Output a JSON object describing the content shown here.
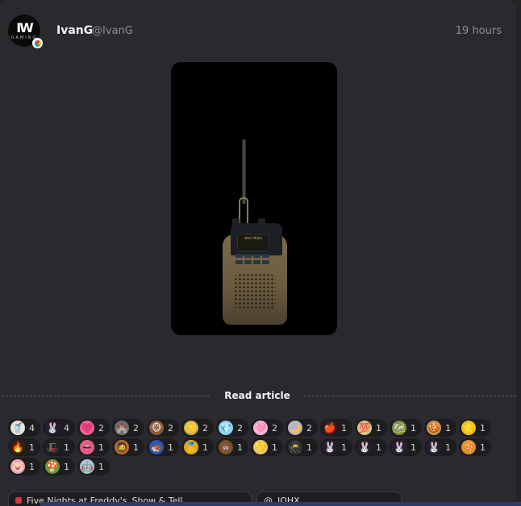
{
  "post": {
    "author_name": "IvanG",
    "author_handle": "@IvanG",
    "timestamp": "19 hours",
    "avatar_logo": "IW",
    "avatar_sub": "GAMING",
    "media_screen_text": "she's there"
  },
  "read_article_label": "Read article",
  "reactions": [
    {
      "icon": "milkshake-icon",
      "glyph": "🥤",
      "bg": "#e8e3dc",
      "count": "4"
    },
    {
      "icon": "bunny-mask-icon",
      "glyph": "🐰",
      "bg": "#2b1b33",
      "count": "4"
    },
    {
      "icon": "pink-heart-icon",
      "glyph": "💗",
      "bg": "#f06292",
      "count": "2"
    },
    {
      "icon": "castle-icon",
      "glyph": "🏰",
      "bg": "#6d6d72",
      "count": "2"
    },
    {
      "icon": "monkey-icon",
      "glyph": "🐵",
      "bg": "#8d5a3a",
      "count": "2"
    },
    {
      "icon": "gold-coin-icon",
      "glyph": "🪙",
      "bg": "#cdb04b",
      "count": "2"
    },
    {
      "icon": "diamond-icon",
      "glyph": "💎",
      "bg": "#8fd3ef",
      "count": "2"
    },
    {
      "icon": "heart-icon",
      "glyph": "🩷",
      "bg": "#f8b8d0",
      "count": "2"
    },
    {
      "icon": "moon-icon",
      "glyph": "🌙",
      "bg": "#b9b6c9",
      "count": "2"
    },
    {
      "icon": "apple-icon",
      "glyph": "🍎",
      "bg": "#3a1a1a",
      "count": "1"
    },
    {
      "icon": "hundred-icon",
      "glyph": "💯",
      "bg": "#d8c890",
      "count": "1"
    },
    {
      "icon": "map-icon",
      "glyph": "🗺",
      "bg": "#7a8f40",
      "count": "1"
    },
    {
      "icon": "cookie-icon",
      "glyph": "🍪",
      "bg": "#c9955a",
      "count": "1"
    },
    {
      "icon": "star-icon",
      "glyph": "⭐",
      "bg": "#f0c020",
      "count": "1"
    },
    {
      "icon": "fire-icon",
      "glyph": "🔥",
      "bg": "#3a2010",
      "count": "1"
    },
    {
      "icon": "top-hat-icon",
      "glyph": "🎩",
      "bg": "#222",
      "count": "1"
    },
    {
      "icon": "lips-icon",
      "glyph": "👄",
      "bg": "#e06080",
      "count": "1"
    },
    {
      "icon": "bearded-face-icon",
      "glyph": "🧔",
      "bg": "#b86a3a",
      "count": "1"
    },
    {
      "icon": "sonic-icon",
      "glyph": "🦔",
      "bg": "#2b56b8",
      "count": "1"
    },
    {
      "icon": "gold-medal-icon",
      "glyph": "🥇",
      "bg": "#e0a820",
      "count": "1"
    },
    {
      "icon": "poop-icon",
      "glyph": "💩",
      "bg": "#7a5028",
      "count": "1"
    },
    {
      "icon": "gold-heart-icon",
      "glyph": "💛",
      "bg": "#e6c86a",
      "count": "1"
    },
    {
      "icon": "hood-icon",
      "glyph": "🥷",
      "bg": "#303038",
      "count": "1"
    },
    {
      "icon": "bunny-mask-icon",
      "glyph": "🐰",
      "bg": "#2b1b33",
      "count": "1"
    },
    {
      "icon": "bunny-mask-icon",
      "glyph": "🐰",
      "bg": "#2b1b33",
      "count": "1"
    },
    {
      "icon": "bunny-mask-icon",
      "glyph": "🐰",
      "bg": "#2b1b33",
      "count": "1"
    },
    {
      "icon": "bunny-mask-icon",
      "glyph": "🐰",
      "bg": "#2b1b33",
      "count": "1"
    },
    {
      "icon": "pizza-icon",
      "glyph": "🍕",
      "bg": "#e09030",
      "count": "1"
    },
    {
      "icon": "pig-icon",
      "glyph": "🐷",
      "bg": "#f2a0b8",
      "count": "1"
    },
    {
      "icon": "mushroom-icon",
      "glyph": "🍄",
      "bg": "#6a9a3a",
      "count": "1"
    },
    {
      "icon": "robot-icon",
      "glyph": "🤖",
      "bg": "#a8c8d8",
      "count": "1"
    }
  ],
  "tags": [
    {
      "label": "Five Nights at Freddy's",
      "suffix": "Show & Tell"
    },
    {
      "label": "IOHX",
      "suffix": ""
    }
  ]
}
